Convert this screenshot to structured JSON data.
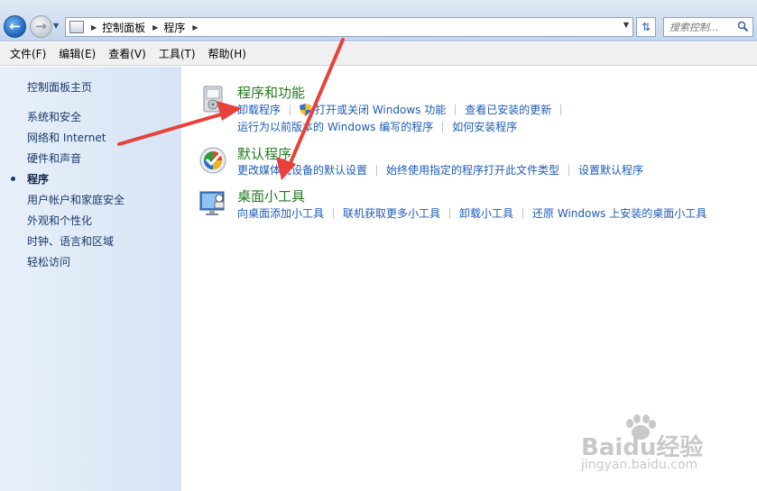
{
  "address_bar": {
    "crumbs": [
      "控制面板",
      "程序"
    ],
    "search_placeholder": "搜索控制..."
  },
  "menu": {
    "items": [
      "文件(F)",
      "编辑(E)",
      "查看(V)",
      "工具(T)",
      "帮助(H)"
    ]
  },
  "sidebar": {
    "home": "控制面板主页",
    "items": [
      "系统和安全",
      "网络和 Internet",
      "硬件和声音",
      "程序",
      "用户帐户和家庭安全",
      "外观和个性化",
      "时钟、语言和区域",
      "轻松访问"
    ],
    "active_index": 3
  },
  "categories": [
    {
      "title": "程序和功能",
      "icon": "programs-features-icon",
      "tasks_row1": [
        "卸载程序",
        "打开或关闭 Windows 功能",
        "查看已安装的更新"
      ],
      "tasks_row2": [
        "运行为以前版本的 Windows 编写的程序",
        "如何安装程序"
      ]
    },
    {
      "title": "默认程序",
      "icon": "default-programs-icon",
      "tasks_row1": [
        "更改媒体或设备的默认设置",
        "始终使用指定的程序打开此文件类型",
        "设置默认程序"
      ]
    },
    {
      "title": "桌面小工具",
      "icon": "desktop-gadgets-icon",
      "tasks_row1": [
        "向桌面添加小工具",
        "联机获取更多小工具",
        "卸载小工具",
        "还原 Windows 上安装的桌面小工具"
      ]
    }
  ],
  "watermark": {
    "logo": "Baidu经验",
    "url": "jingyan.baidu.com"
  },
  "colors": {
    "link": "#1d5bb8",
    "category_title": "#227b1d",
    "annotation_arrow": "#e8413a"
  }
}
